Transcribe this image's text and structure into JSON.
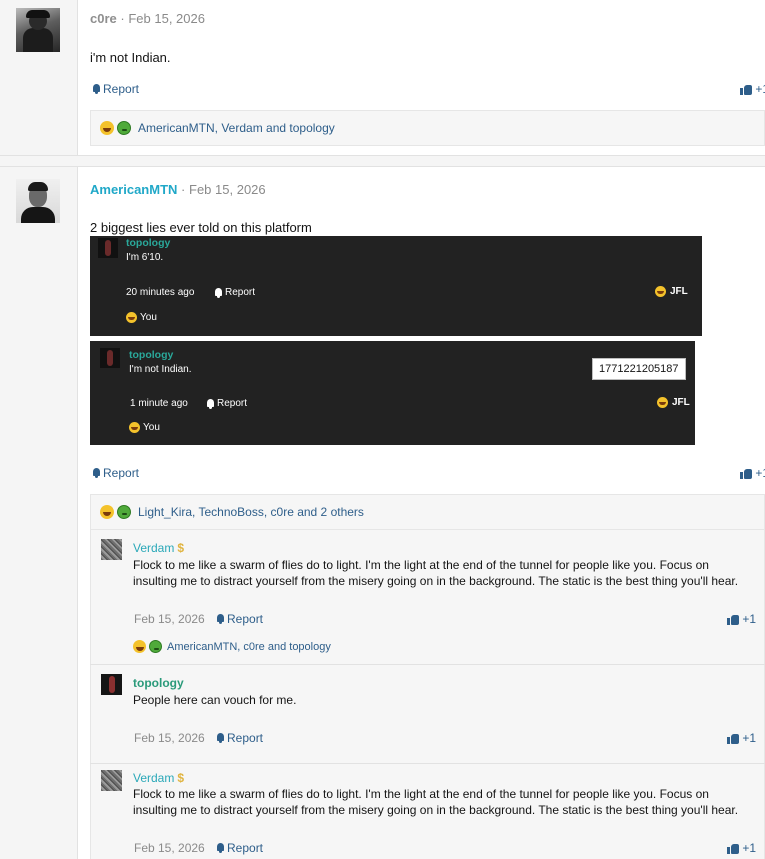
{
  "post1": {
    "author": "c0re",
    "date": "Feb 15, 2026",
    "text": "i'm not Indian.",
    "report_label": "Report",
    "like_count": "+1",
    "reactions": "AmericanMTN, Verdam and topology"
  },
  "post2": {
    "author": "AmericanMTN",
    "date": "Feb 15, 2026",
    "text": "2 biggest lies ever told on this platform",
    "report_label": "Report",
    "like_count": "+1",
    "reactions": "Light_Kira, TechnoBoss, c0re and 2 others",
    "screenshots": [
      {
        "author": "topology",
        "text": "I'm 6'10.",
        "time": "20 minutes ago",
        "report_label": "Report",
        "reaction_label": "JFL",
        "reactor": "You"
      },
      {
        "author": "topology",
        "text": "I'm not Indian.",
        "time": "1 minute ago",
        "report_label": "Report",
        "reaction_label": "JFL",
        "reactor": "You",
        "tooltip": "1771221205187"
      }
    ]
  },
  "replies": [
    {
      "author": "Verdam",
      "badge": "$",
      "text": "Flock to me like a swarm of flies do to light. I'm the light at the end of the tunnel for people like you. Focus on insulting me to distract yourself from the misery going on in the background. The static is the best thing you'll hear.",
      "date": "Feb 15, 2026",
      "report_label": "Report",
      "like_count": "+1",
      "reactions": "AmericanMTN, c0re and topology"
    },
    {
      "author": "topology",
      "text": "People here can vouch for me.",
      "date": "Feb 15, 2026",
      "report_label": "Report",
      "like_count": "+1"
    },
    {
      "author": "Verdam",
      "badge": "$",
      "text": "Flock to me like a swarm of flies do to light. I'm the light at the end of the tunnel for people like you. Focus on insulting me to distract yourself from the misery going on in the background. The static is the best thing you'll hear.",
      "date": "Feb 15, 2026",
      "report_label": "Report",
      "like_count": "+1"
    }
  ],
  "separator": "·"
}
